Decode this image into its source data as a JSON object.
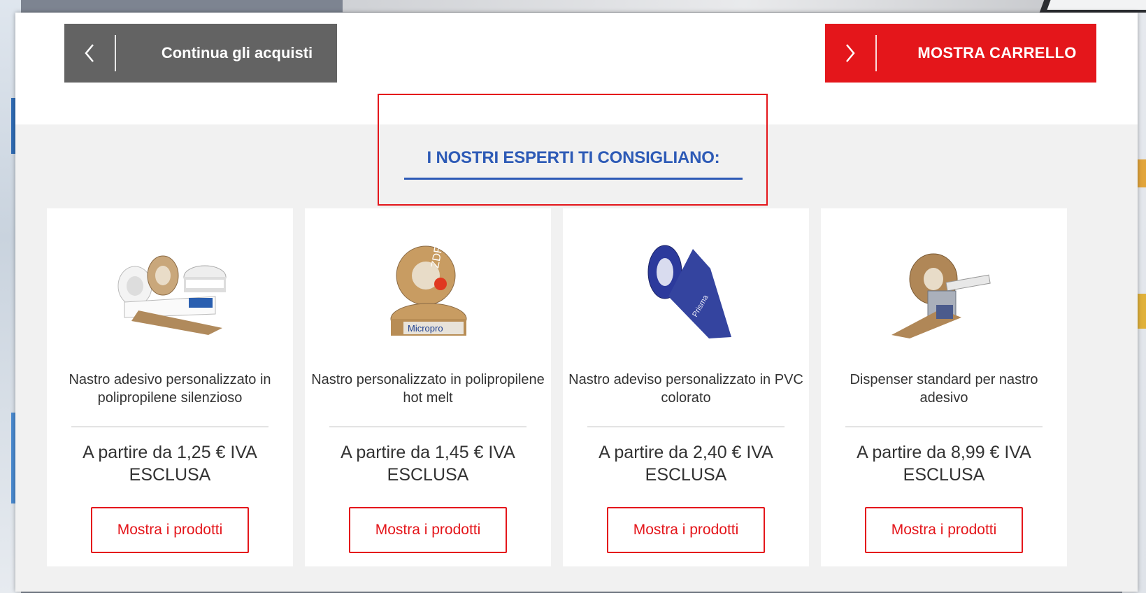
{
  "navigation": {
    "continue_label": "Continua gli acquisti",
    "cart_label": "MOSTRA CARRELLO"
  },
  "recommendations": {
    "title": "I NOSTRI ESPERTI TI CONSIGLIANO:",
    "products": [
      {
        "name": "Nastro adesivo personalizzato in polipropilene silenzioso",
        "price": "A partire da 1,25 € IVA ESCLUSA",
        "button": "Mostra i prodotti",
        "image": "printed-tape-rolls"
      },
      {
        "name": "Nastro personalizzato in polipropilene hot melt",
        "price": "A partire da 1,45 € IVA ESCLUSA",
        "button": "Mostra i prodotti",
        "image": "brown-tape-rolls"
      },
      {
        "name": "Nastro adeviso personalizzato in PVC colorato",
        "price": "A partire da 2,40 € IVA ESCLUSA",
        "button": "Mostra i prodotti",
        "image": "blue-tape-roll"
      },
      {
        "name": "Dispenser standard per nastro adesivo",
        "price": "A partire da 8,99 € IVA ESCLUSA",
        "button": "Mostra i prodotti",
        "image": "tape-dispenser"
      }
    ]
  },
  "colors": {
    "accent_red": "#e4161b",
    "title_blue": "#2d5ab6",
    "continue_gray": "#636363"
  },
  "icons": {
    "back": "chevron-left-icon",
    "forward": "chevron-right-icon"
  }
}
